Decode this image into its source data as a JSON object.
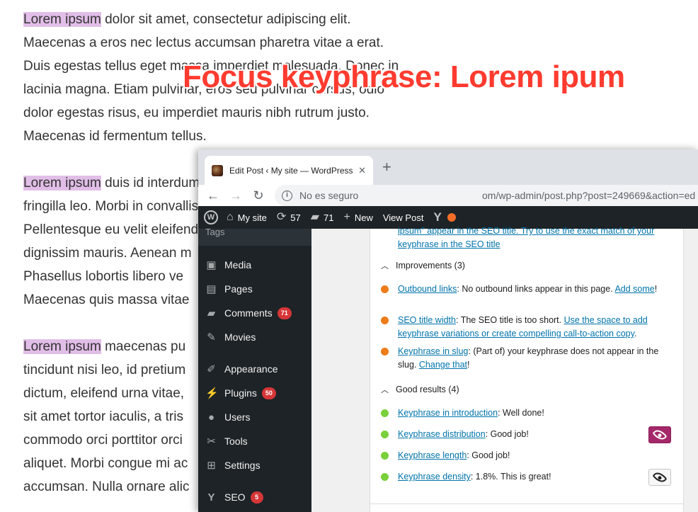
{
  "article": {
    "paragraphs": [
      {
        "highlight": "Lorem ipsum",
        "lines": [
          " dolor sit amet, consectetur adipiscing elit.",
          "Maecenas a eros nec lectus accumsan pharetra vitae a erat.",
          "Duis egestas tellus eget massa imperdiet malesuada. Donec in",
          "lacinia magna. Etiam pulvinar, eros sed pulvinar cursus, odio",
          "dolor egestas risus, eu imperdiet mauris nibh rutrum justo.",
          "Maecenas id fermentum tellus."
        ]
      },
      {
        "highlight": "Lorem ipsum",
        "lines": [
          " duis id interdum",
          "fringilla leo. Morbi in convallis",
          "Pellentesque eu velit eleifend",
          "dignissim mauris. Aenean m",
          "Phasellus lobortis libero ve",
          "Maecenas quis massa vitae"
        ]
      },
      {
        "highlight": "Lorem ipsum",
        "lines": [
          " maecenas pu",
          "tincidunt nisi leo, id pretium",
          "dictum, eleifend urna vitae,",
          "sit amet tortor iaculis, a tris",
          "commodo orci porttitor orci",
          "aliquet. Morbi congue mi ac",
          "accumsan. Nulla ornare alic"
        ]
      }
    ]
  },
  "caption": "Focus keyphrase: Lorem ipum",
  "browser": {
    "tab_title": "Edit Post ‹ My site — WordPress",
    "tab_close": "✕",
    "new_tab": "+",
    "security_label": "No es seguro",
    "url": "om/wp-admin/post.php?post=249669&action=ed"
  },
  "adminbar": {
    "site_name": "My site",
    "updates_count": "57",
    "comments_count": "71",
    "new_label": "New",
    "view_post_label": "View Post"
  },
  "sidebar": {
    "top_label": "Tags",
    "items": [
      {
        "label": "Media",
        "icon": "media-icon",
        "badge": ""
      },
      {
        "label": "Pages",
        "icon": "pages-icon",
        "badge": ""
      },
      {
        "label": "Comments",
        "icon": "comments-icon",
        "badge": "71"
      },
      {
        "label": "Movies",
        "icon": "pin-icon",
        "badge": ""
      },
      {
        "label": "Appearance",
        "icon": "brush-icon",
        "badge": ""
      },
      {
        "label": "Plugins",
        "icon": "plugin-icon",
        "badge": "50"
      },
      {
        "label": "Users",
        "icon": "users-icon",
        "badge": ""
      },
      {
        "label": "Tools",
        "icon": "wrench-icon",
        "badge": ""
      },
      {
        "label": "Settings",
        "icon": "settings-icon",
        "badge": ""
      },
      {
        "label": "SEO",
        "icon": "yoast-icon",
        "badge": "5"
      }
    ]
  },
  "seo": {
    "top_partial_1": "ipsum\" appear in the SEO title. Try to use the exact match of your",
    "top_link_2": "keyphrase in the SEO title",
    "improvements_heading": "Improvements (3)",
    "improvements": [
      {
        "link": "Outbound links",
        "text": ": No outbound links appear in this page. ",
        "link2": "Add some",
        "after": "!"
      },
      {
        "link": "SEO title width",
        "text": ": The SEO title is too short. ",
        "link2": "Use the space to add keyphrase variations or create compelling call-to-action copy",
        "after": "."
      },
      {
        "link": "Keyphrase in slug",
        "text": ": (Part of) your keyphrase does not appear in the slug. ",
        "link2": "Change that",
        "after": "!"
      }
    ],
    "good_heading": "Good results (4)",
    "good": [
      {
        "link": "Keyphrase in introduction",
        "text": ": Well done!"
      },
      {
        "link": "Keyphrase distribution",
        "text": ": Good job!"
      },
      {
        "link": "Keyphrase length",
        "text": ": Good job!"
      },
      {
        "link": "Keyphrase density",
        "text": ": 1.8%. This is great!"
      }
    ]
  },
  "colors": {
    "highlight": "#e1bee7",
    "caption": "#ff3b2f",
    "admin_bar": "#1d2327",
    "problem_dot": "#ee7c1b",
    "good_dot": "#7ad03a",
    "eye_active": "#a4286a",
    "link": "#0073aa"
  }
}
